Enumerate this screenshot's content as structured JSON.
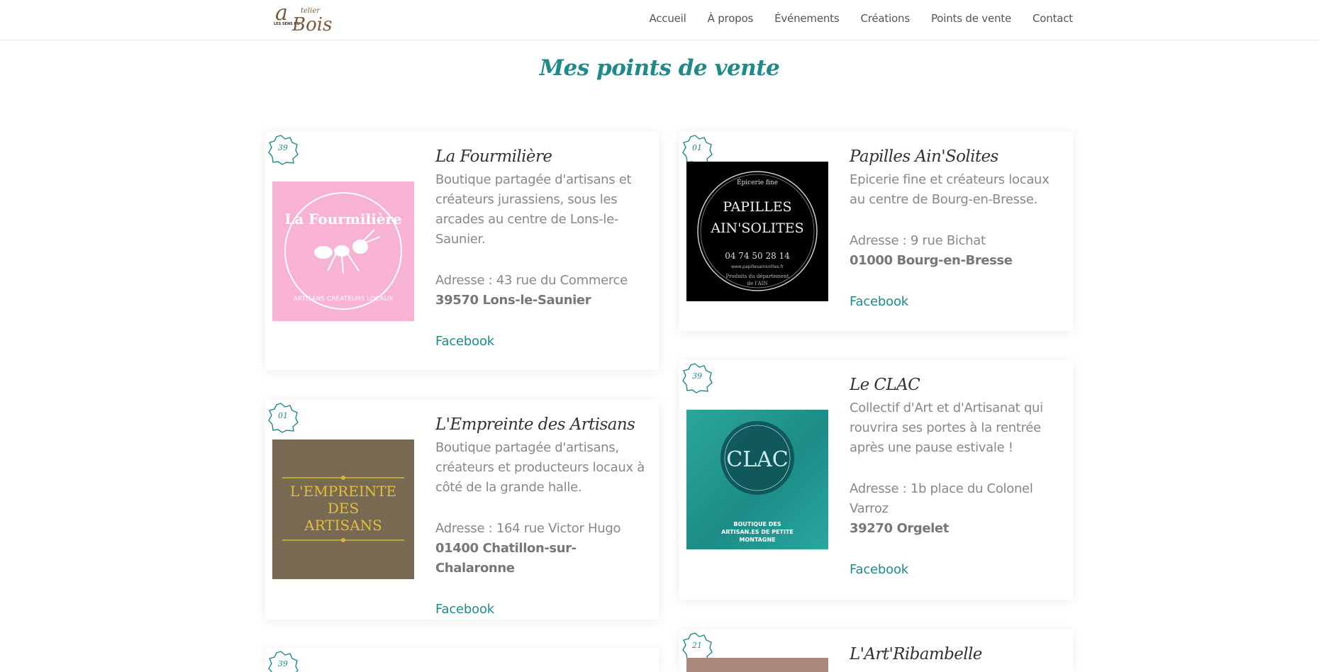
{
  "header": {
    "logo": {
      "line1": "telier",
      "big": "a",
      "bois": "Bois",
      "mini": "LES SENS DU"
    },
    "nav": [
      "Accueil",
      "À propos",
      "Événements",
      "Créations",
      "Points de vente",
      "Contact"
    ]
  },
  "page": {
    "title": "Mes points de vente"
  },
  "shops": [
    {
      "badge": "39",
      "name": "La Fourmilière",
      "description": "Boutique partagée d'artisans et créateurs jurassiens, sous les arcades au centre de Lons-le-Saunier.",
      "address": "Adresse : 43 rue du Commerce",
      "city": "39570 Lons-le-Saunier",
      "link": "Facebook",
      "image": {
        "top_text": "La Fourmilière",
        "bottom_text": "ARTISANS CRÉATEURS LOCAUX",
        "icon": "ant-icon"
      }
    },
    {
      "badge": "01",
      "name": "Papilles Ain'Solites",
      "description": "Epicerie fine et créateurs locaux au centre de Bourg-en-Bresse.",
      "address": "Adresse : 9 rue Bichat",
      "city": "01000 Bourg-en-Bresse",
      "link": "Facebook",
      "image": {
        "line1": "Épicerie fine",
        "line2": "PAPILLES",
        "line3": "AIN'SOLITES",
        "phone": "04 74 50 28 14",
        "site": "www.papillesainsolites.fr",
        "footer1": "Produits du département",
        "footer2": "de l'AIN"
      }
    },
    {
      "badge": "01",
      "name": "L'Empreinte des Artisans",
      "description": "Boutique partagée d'artisans, créateurs et producteurs locaux à côté de la grande halle.",
      "address": "Adresse : 164 rue Victor Hugo",
      "city": "01400 Chatillon-sur-Chalaronne",
      "link": "Facebook",
      "image": {
        "line1": "L'EMPREINTE",
        "line2": "DES",
        "line3": "ARTISANS"
      }
    },
    {
      "badge": "39",
      "name": "Le CLAC",
      "description": "Collectif d'Art et d'Artisanat qui rouvrira ses portes à la rentrée après une pause estivale !",
      "address": "Adresse : 1b place du Colonel Varroz",
      "city": "39270 Orgelet",
      "link": "Facebook",
      "image": {
        "logo": "CLAC",
        "line1": "BOUTIQUE DES",
        "line2": "ARTISAN.ES DE PETITE",
        "line3": "MONTAGNE"
      }
    },
    {
      "badge": "39",
      "name": ""
    },
    {
      "badge": "21",
      "name": "L'Art'Ribambelle"
    }
  ],
  "colors": {
    "accent": "#1f8a8a",
    "text": "#888888"
  }
}
